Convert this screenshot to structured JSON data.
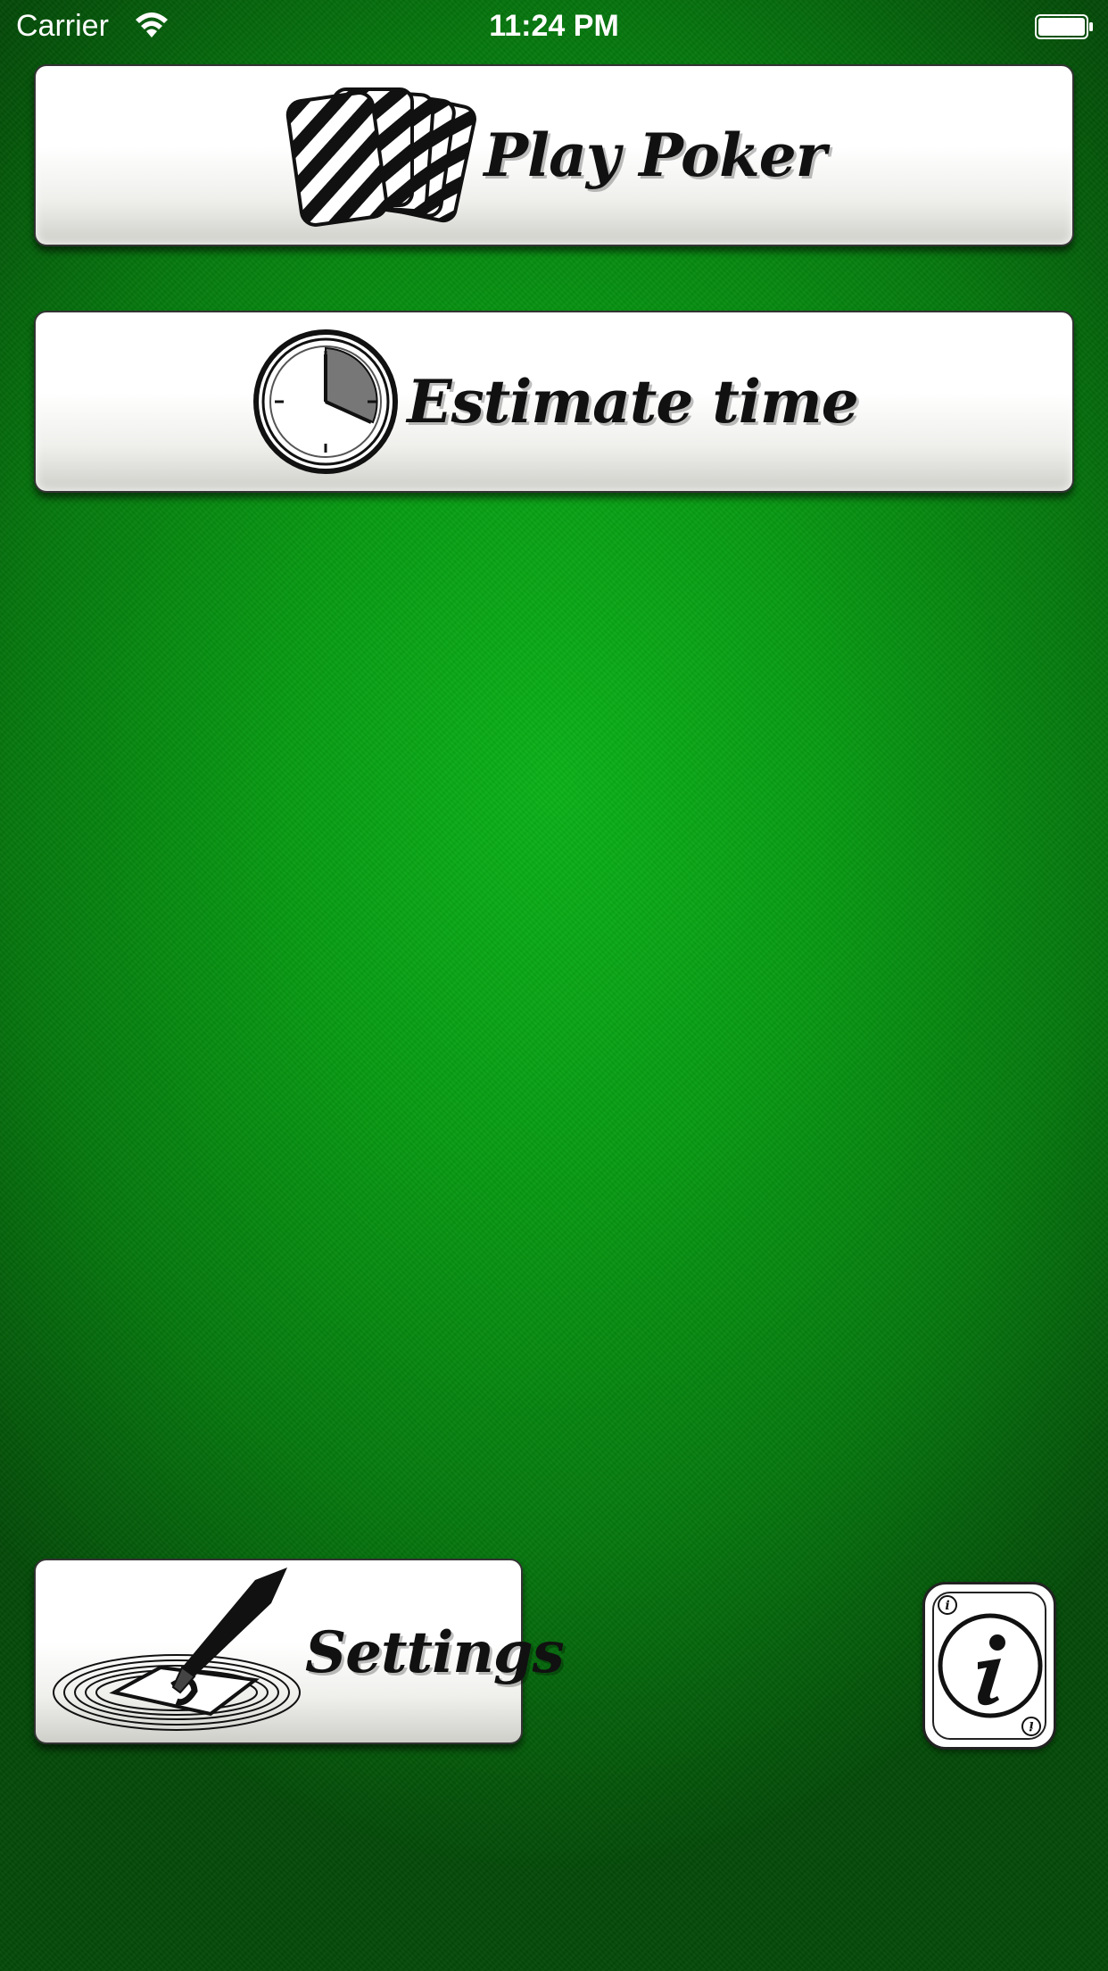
{
  "status_bar": {
    "carrier": "Carrier",
    "time": "11:24 PM"
  },
  "menu": {
    "play_poker_label": "Play Poker",
    "estimate_time_label": "Estimate time",
    "settings_label": "Settings"
  },
  "icons": {
    "play_poker": "cards-icon",
    "estimate_time": "stopwatch-icon",
    "settings": "pen-and-card-icon",
    "info": "info-icon",
    "wifi": "wifi-icon",
    "battery": "battery-icon"
  },
  "colors": {
    "background": "#089c13",
    "button_face": "#ffffff",
    "ink": "#111111"
  }
}
